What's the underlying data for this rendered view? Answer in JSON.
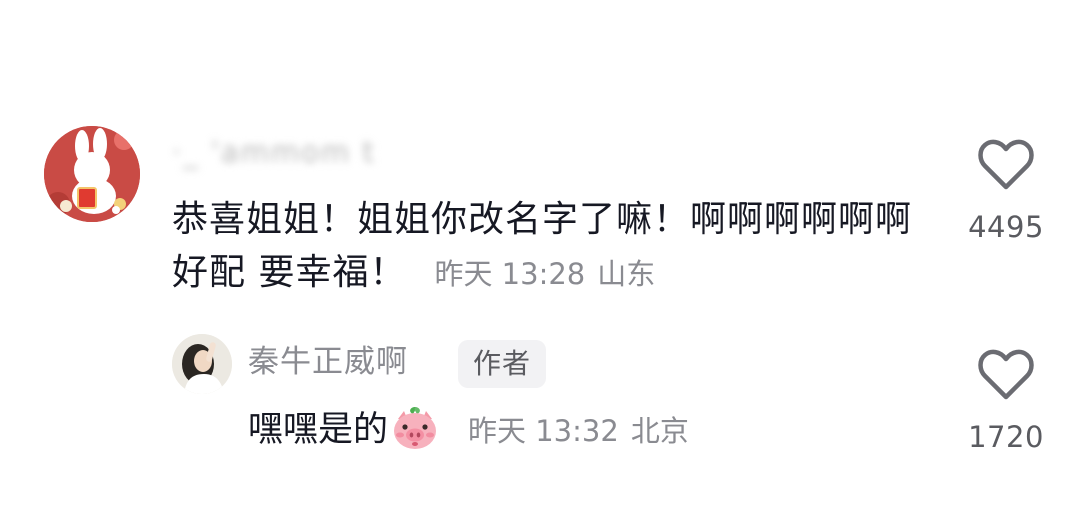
{
  "main_comment": {
    "username": "·_ 'ammom t",
    "text": "恭喜姐姐！姐姐你改名字了嘛！啊啊啊啊啊啊好配 要幸福！",
    "time": "昨天 13:28",
    "location": "山东",
    "like_count": "4495"
  },
  "reply": {
    "username": "秦牛正威啊",
    "badge": "作者",
    "text": "嘿嘿是的",
    "emoji": "pig-face-emoji",
    "time": "昨天 13:32",
    "location": "北京",
    "like_count": "1720"
  },
  "icons": {
    "like": "heart-outline-icon"
  },
  "colors": {
    "primary_text": "#161823",
    "secondary_text": "#8a8b91",
    "icon": "#6b6c72",
    "badge_bg": "#f2f2f4"
  }
}
